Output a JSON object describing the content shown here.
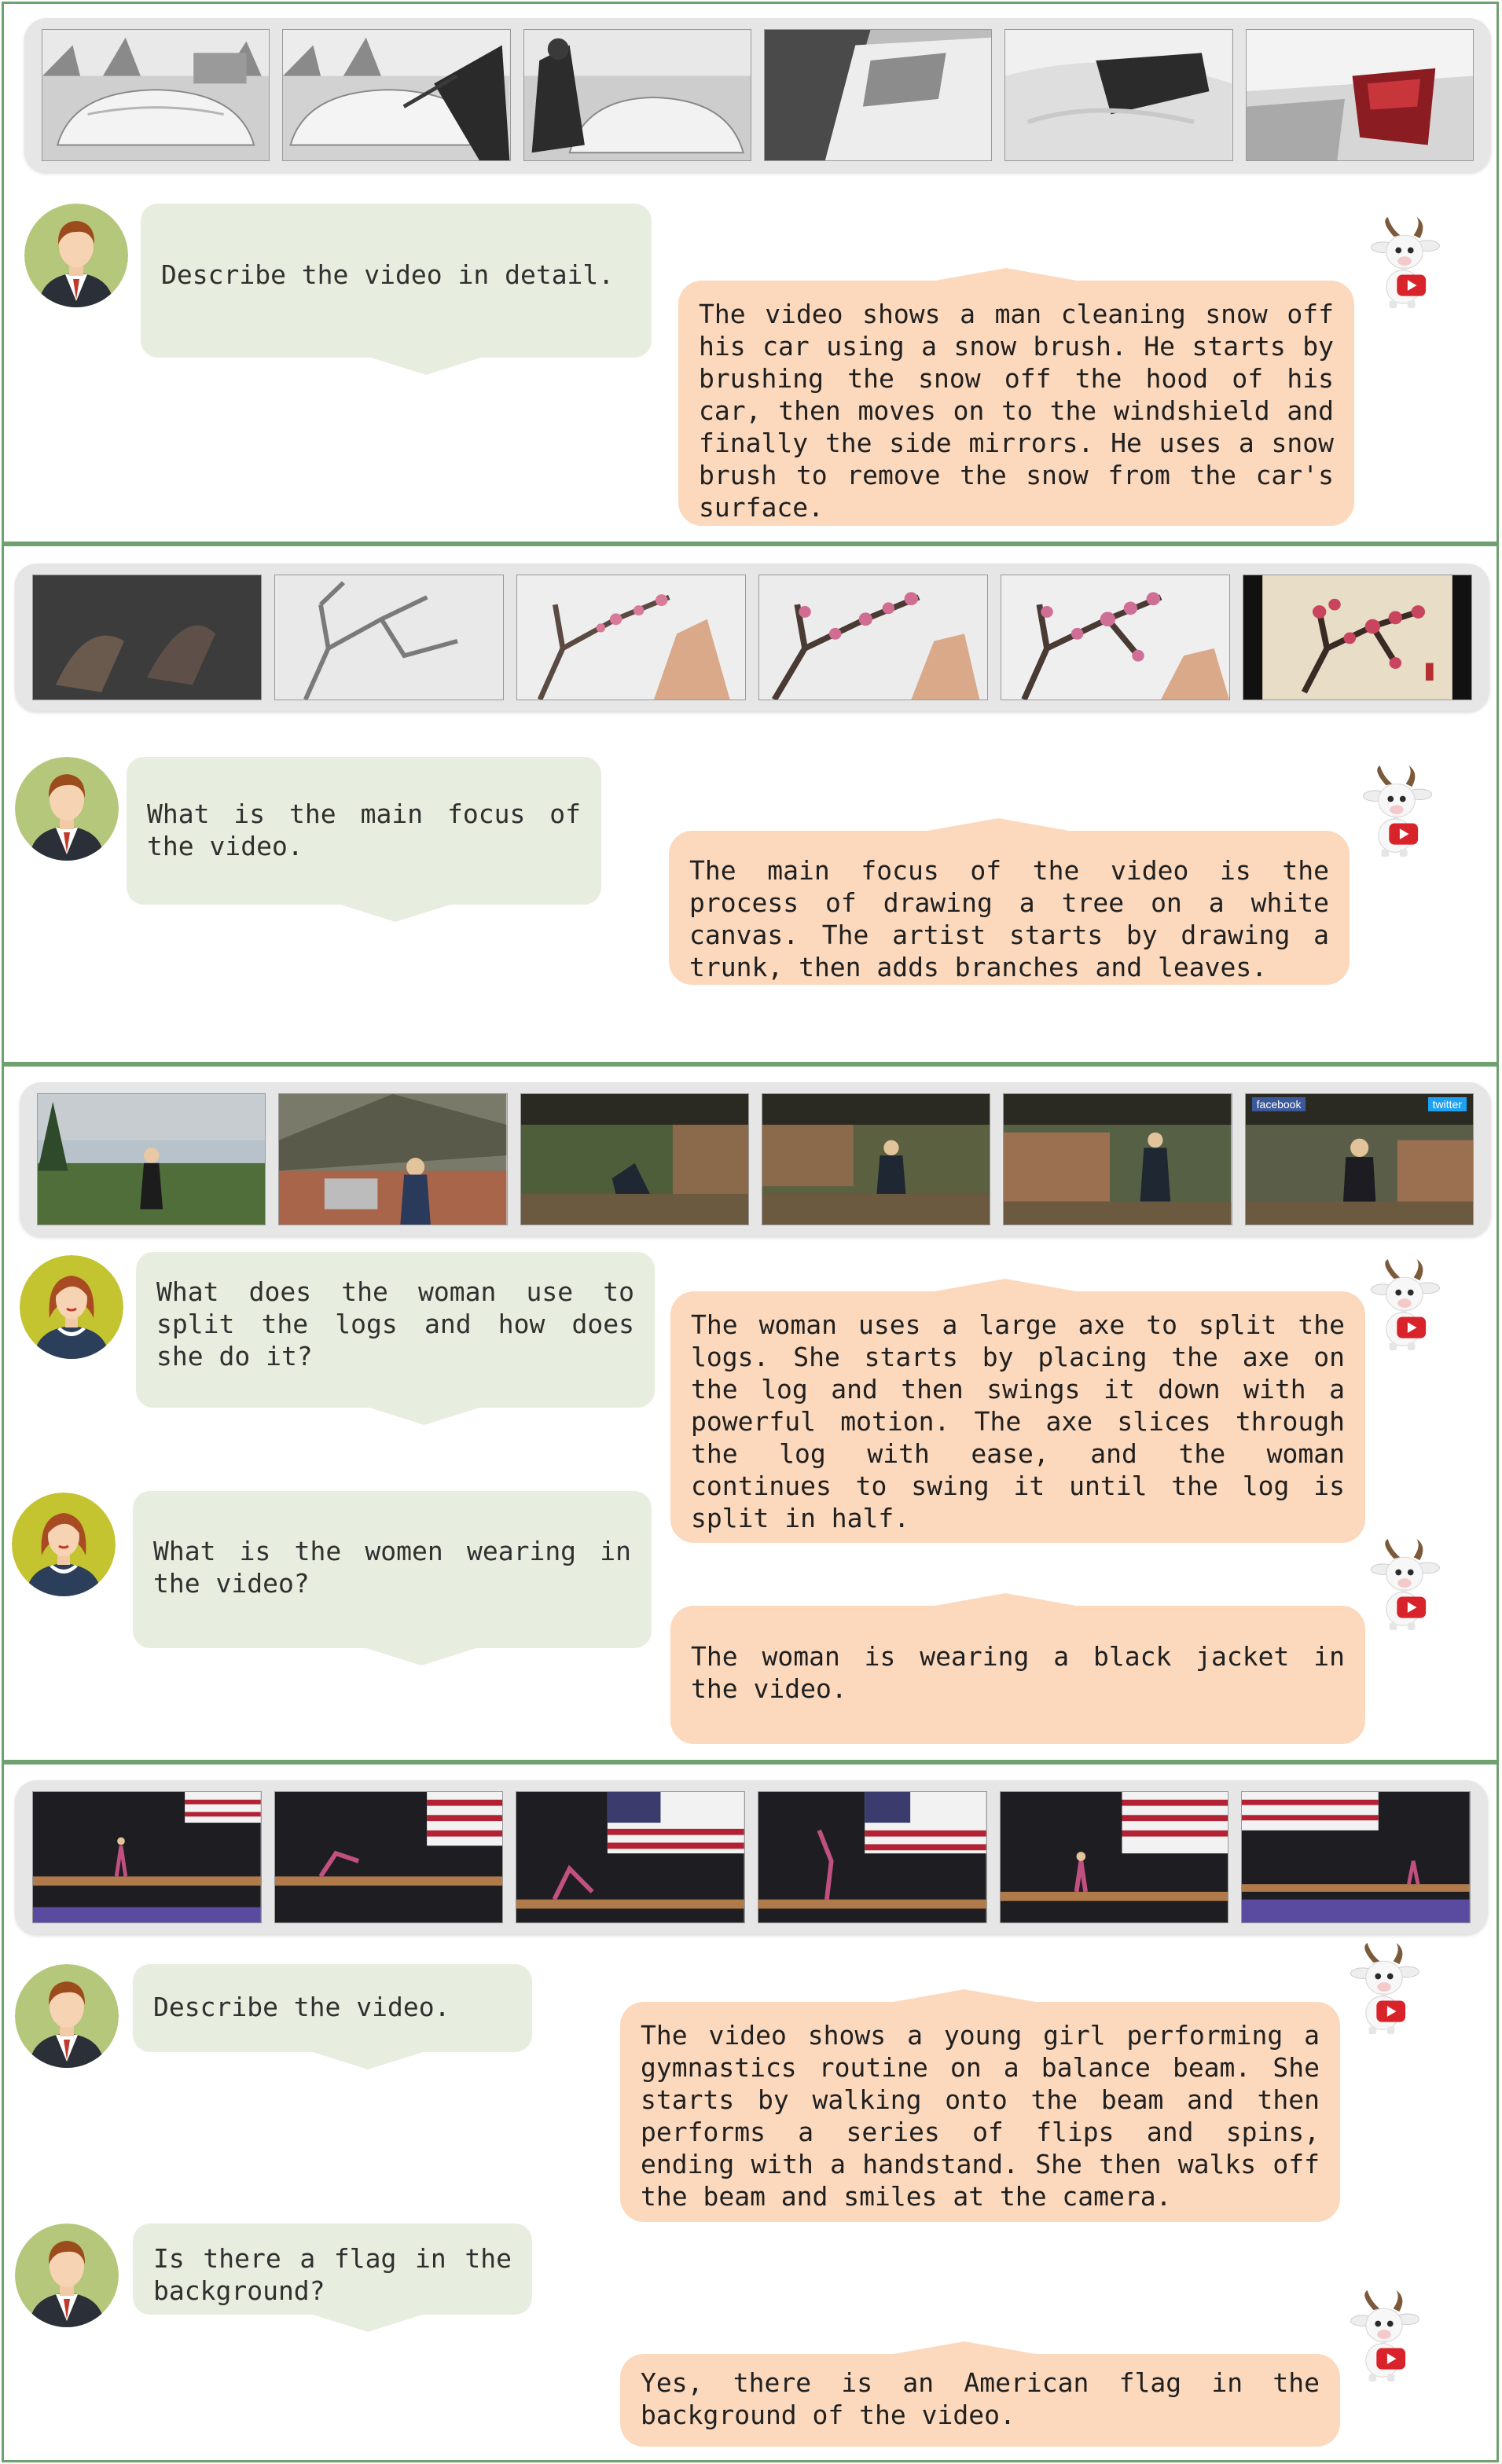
{
  "examples": [
    {
      "turns": [
        {
          "question": "Describe the video in detail.",
          "answer": "The video shows a man cleaning snow off his car using a snow brush. He starts by brushing the snow off the hood of his car, then moves on to the windshield and finally the side mirrors. He uses a snow brush to remove the snow from the car's surface."
        }
      ]
    },
    {
      "turns": [
        {
          "question": "What is the main focus of the video.",
          "answer": "The main focus of the video is the process of drawing a tree on a white canvas. The artist starts by drawing a trunk, then adds branches and leaves."
        }
      ]
    },
    {
      "turns": [
        {
          "question": "What does the woman use to split the logs and how does she do it?",
          "answer": "The woman uses a large axe to split the logs. She starts by placing the axe on the log and then swings it down with a powerful motion. The axe slices through the log with ease, and the woman continues to swing it until the log is split in half."
        },
        {
          "question": "What is the women wearing in the video?",
          "answer": "The woman is wearing a black jacket in the video."
        }
      ]
    },
    {
      "turns": [
        {
          "question": "Describe the video.",
          "answer": "The video shows a young girl performing a gymnastics routine on a balance beam. She starts by walking onto the beam and then performs a series of flips and spins, ending with a handstand. She then walks off the beam and smiles at the camera."
        },
        {
          "question": "Is there a flag in the background?",
          "answer": "Yes, there is an American flag in the background of the video."
        }
      ]
    }
  ],
  "frame_logos": {
    "facebook": "facebook",
    "twitter": "twitter"
  },
  "icons": {
    "user_avatar_male": "user-avatar-male-icon",
    "user_avatar_female": "user-avatar-female-icon",
    "assistant": "goat-mascot-icon"
  },
  "colors": {
    "panel_border": "#6fa06f",
    "user_bubble": "#e7eedf",
    "assistant_bubble": "#fcd9bd",
    "strip_bg": "#e6e6e6"
  }
}
